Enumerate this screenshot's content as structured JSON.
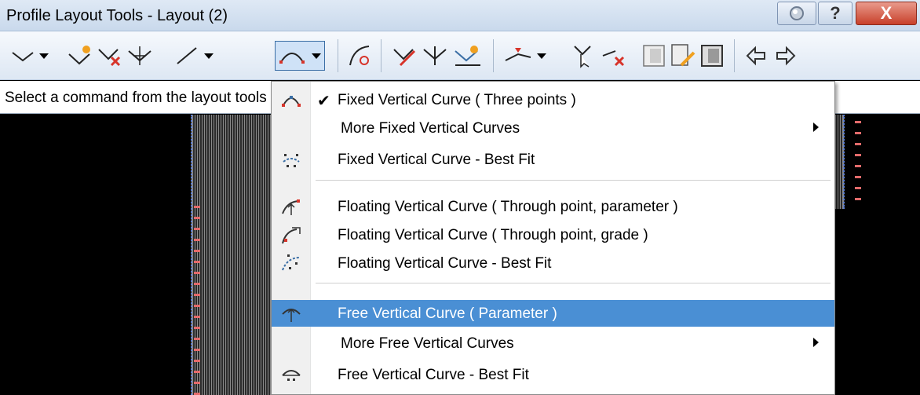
{
  "window": {
    "title": "Profile Layout Tools - Layout (2)",
    "help_label": "?",
    "close_label": "X"
  },
  "status": {
    "text": "Select a command from the layout tools"
  },
  "menu": {
    "items": [
      {
        "label": "Fixed Vertical Curve ( Three points )",
        "checked": true,
        "icon": "fixed-curve-three-points-icon"
      },
      {
        "label": "More Fixed Vertical Curves",
        "submenu": true
      },
      {
        "label": "Fixed Vertical Curve - Best Fit",
        "icon": "fixed-curve-best-fit-icon"
      },
      {
        "label": "Floating Vertical Curve ( Through point, parameter )",
        "icon": "floating-curve-parameter-icon"
      },
      {
        "label": "Floating Vertical Curve ( Through point, grade )",
        "icon": "floating-curve-grade-icon"
      },
      {
        "label": "Floating Vertical Curve - Best Fit",
        "icon": "floating-curve-best-fit-icon"
      },
      {
        "label": "Free Vertical Curve ( Parameter )",
        "icon": "free-curve-parameter-icon",
        "highlighted": true
      },
      {
        "label": "More Free Vertical Curves",
        "submenu": true
      },
      {
        "label": "Free Vertical Curve - Best Fit",
        "icon": "free-curve-best-fit-icon"
      }
    ],
    "check_glyph": "✔"
  },
  "colors": {
    "highlight": "#4a8fd4",
    "accent_red": "#d7342a",
    "accent_orange": "#f0a020"
  }
}
